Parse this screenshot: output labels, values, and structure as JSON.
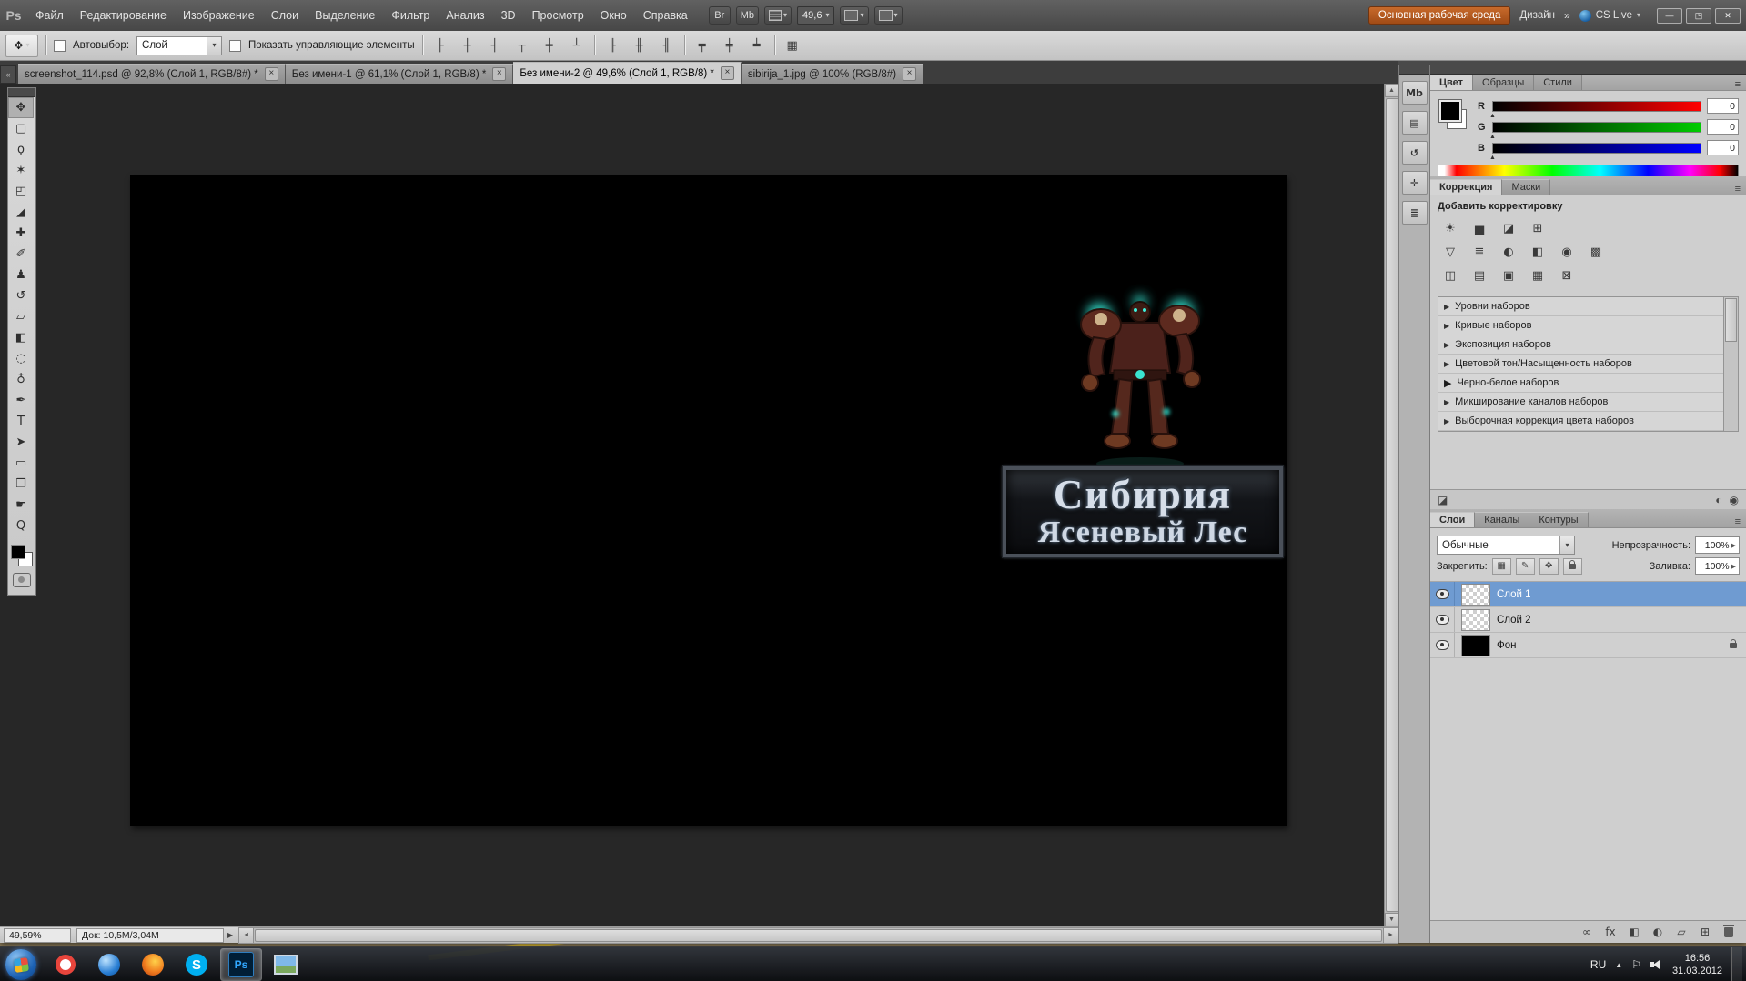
{
  "colors": {
    "workspace_button_orange": "#b55a20",
    "layer_selection_blue": "#6f9bd1",
    "skype_blue": "#00aff0",
    "photoshop_blue": "#31a8ff",
    "logo_glow_teal": "#35e0cf",
    "canvas_black": "#000000"
  },
  "icons": {
    "caret_down": "▾",
    "close": "×",
    "menu": "≡",
    "collapse_left": "«",
    "collapse_right": "»",
    "tri_right": "▶",
    "tri_up": "▲",
    "tri_down": "▼",
    "arrow_left": "◄",
    "arrow_right": "►",
    "window_min": "—",
    "window_restore": "◳",
    "window_close": "✕",
    "flag": "⚐"
  },
  "menu_bar": {
    "logo": "Ps",
    "items": [
      "Файл",
      "Редактирование",
      "Изображение",
      "Слои",
      "Выделение",
      "Фильтр",
      "Анализ",
      "3D",
      "Просмотр",
      "Окно",
      "Справка"
    ],
    "br_button": "Br",
    "mb_button": "Mb",
    "zoom_value": "49,6",
    "workspace_primary": "Основная рабочая среда",
    "workspace_design": "Дизайн",
    "workspace_more": "»",
    "cs_live": "CS Live"
  },
  "options_bar": {
    "autoselect_label": "Автовыбор:",
    "autoselect_value": "Слой",
    "show_controls_label": "Показать управляющие элементы",
    "align_glyphs": [
      "├",
      "┼",
      "┤",
      "┬",
      "┿",
      "┴",
      "╟",
      "╫",
      "╢",
      "╤",
      "╪",
      "╧",
      "▦"
    ]
  },
  "document_tabs": [
    {
      "title": "screenshot_114.psd @ 92,8% (Слой 1, RGB/8#) *"
    },
    {
      "title": "Без имени-1 @ 61,1% (Слой 1, RGB/8) *"
    },
    {
      "title": "Без имени-2 @ 49,6% (Слой 1, RGB/8) *"
    },
    {
      "title": "sibirija_1.jpg @ 100% (RGB/8#)"
    }
  ],
  "tools": {
    "glyphs": [
      "✥",
      "▢",
      "ϙ",
      "✶",
      "◰",
      "◢",
      "✚",
      "✐",
      "♟",
      "↺",
      "▱",
      "◧",
      "◌",
      "♁",
      "✒",
      "T",
      "➤",
      "▭",
      "❒",
      "☛",
      "Q"
    ]
  },
  "panel_strip": {
    "glyphs": [
      "Mb",
      "▤",
      "↺",
      "✛",
      "≣"
    ]
  },
  "color_panel": {
    "tabs": [
      "Цвет",
      "Образцы",
      "Стили"
    ],
    "channels": [
      {
        "label": "R",
        "value": "0"
      },
      {
        "label": "G",
        "value": "0"
      },
      {
        "label": "B",
        "value": "0"
      }
    ]
  },
  "adjustments_panel": {
    "tabs": [
      "Коррекция",
      "Маски"
    ],
    "title": "Добавить корректировку",
    "icon_rows": [
      [
        "☀",
        "▅",
        "◪",
        "⊞"
      ],
      [
        "▽",
        "≣",
        "◐",
        "◧",
        "◉",
        "▩"
      ],
      [
        "◫",
        "▤",
        "▣",
        "▦",
        "⊠"
      ]
    ],
    "presets": [
      "Уровни наборов",
      "Кривые наборов",
      "Экспозиция наборов",
      "Цветовой тон/Насыщенность наборов",
      "Черно-белое наборов",
      "Микширование каналов наборов",
      "Выборочная коррекция цвета наборов"
    ],
    "footer_icons": [
      "◪",
      "◐",
      "◉"
    ]
  },
  "layers_panel": {
    "tabs": [
      "Слои",
      "Каналы",
      "Контуры"
    ],
    "blend_mode": "Обычные",
    "opacity_label": "Непрозрачность:",
    "opacity_value": "100%",
    "lock_label": "Закрепить:",
    "lock_glyphs": [
      "▦",
      "✎",
      "✥"
    ],
    "fill_label": "Заливка:",
    "fill_value": "100%",
    "layers": [
      {
        "name": "Слой 1"
      },
      {
        "name": "Слой 2"
      },
      {
        "name": "Фон"
      }
    ],
    "footer_icons": [
      "∞",
      "fx",
      "◧",
      "◐",
      "▱",
      "⊞"
    ]
  },
  "canvas": {
    "logo_line1": "Сибирия",
    "logo_line2": "Ясеневый Лес"
  },
  "status_bar": {
    "zoom": "49,59%",
    "doc_info": "Док: 10,5М/3,04М"
  },
  "taskbar": {
    "lang": "RU",
    "time": "16:56",
    "date": "31.03.2012",
    "skype_letter": "S",
    "ps_label": "Ps"
  }
}
